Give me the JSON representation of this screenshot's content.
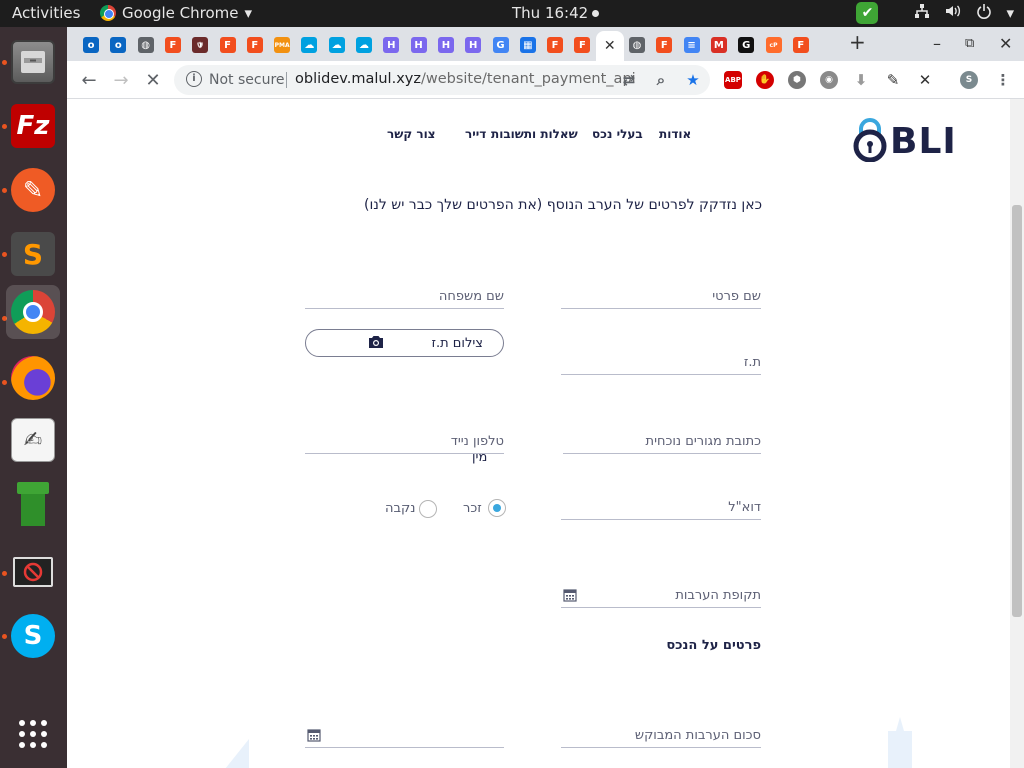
{
  "os": {
    "activities": "Activities",
    "app_name": "Google Chrome",
    "app_menu_arrow": "▾",
    "clock": "Thu 16:42",
    "tray": {
      "network_icon": "network-icon",
      "volume_icon": "volume-icon",
      "power_icon": "power-icon",
      "power_arrow": "▾"
    }
  },
  "dock": {
    "items": [
      {
        "name": "files",
        "label": "🗄",
        "color": "#6f6f6f"
      },
      {
        "name": "filezilla",
        "label": "Fz",
        "color": "#bf0000"
      },
      {
        "name": "postman",
        "label": "✎",
        "color": "#ef5b25"
      },
      {
        "name": "sublime-text",
        "label": "S",
        "color": "#4a4a4a"
      },
      {
        "name": "google-chrome",
        "label": "",
        "color": "#ffffff"
      },
      {
        "name": "firefox",
        "label": "",
        "color": "#e66000"
      },
      {
        "name": "text-editor",
        "label": "✍",
        "color": "#e8e8e8"
      },
      {
        "name": "pipe-app",
        "label": "",
        "color": "#3fa535"
      },
      {
        "name": "blocked-app",
        "label": "⃠",
        "color": "#222222"
      },
      {
        "name": "skype",
        "label": "S",
        "color": "#00aff0"
      },
      {
        "name": "show-applications",
        "label": "⋮⋮⋮",
        "color": "transparent"
      }
    ]
  },
  "browser": {
    "tabs": [
      {
        "icon": "o",
        "color": "#0a66c2"
      },
      {
        "icon": "o",
        "color": "#0a66c2"
      },
      {
        "icon": "◍",
        "color": "#5f6368"
      },
      {
        "icon": "F",
        "color": "#f24e1e"
      },
      {
        "icon": "🛡",
        "color": "#6b2a2a"
      },
      {
        "icon": "F",
        "color": "#f24e1e"
      },
      {
        "icon": "F",
        "color": "#f24e1e"
      },
      {
        "icon": "PMA",
        "color": "#f29111"
      },
      {
        "icon": "☁",
        "color": "#00a1e0"
      },
      {
        "icon": "☁",
        "color": "#00a1e0"
      },
      {
        "icon": "☁",
        "color": "#00a1e0"
      },
      {
        "icon": "H",
        "color": "#7b68ee"
      },
      {
        "icon": "H",
        "color": "#7b68ee"
      },
      {
        "icon": "H",
        "color": "#7b68ee"
      },
      {
        "icon": "H",
        "color": "#7b68ee"
      },
      {
        "icon": "G",
        "color": "#4285f4"
      },
      {
        "icon": "▦",
        "color": "#1a73e8"
      },
      {
        "icon": "F",
        "color": "#f24e1e"
      },
      {
        "icon": "F",
        "color": "#f24e1e"
      },
      {
        "icon": "✕",
        "color": "#333333",
        "active": true
      },
      {
        "icon": "◍",
        "color": "#5f6368"
      },
      {
        "icon": "F",
        "color": "#f24e1e"
      },
      {
        "icon": "≡",
        "color": "#4285f4"
      },
      {
        "icon": "M",
        "color": "#d93025"
      },
      {
        "icon": "G",
        "color": "#111111"
      },
      {
        "icon": "cP",
        "color": "#ff6c2c"
      },
      {
        "icon": "F",
        "color": "#f24e1e"
      }
    ],
    "new_tab": "+",
    "window_controls": {
      "minimize": "–",
      "restore": "⧉",
      "close": "✕"
    },
    "nav": {
      "back": "←",
      "forward": "→",
      "stop": "✕"
    },
    "omnibox": {
      "security_icon": "i",
      "security_text": "Not secure",
      "url_host": "oblidev.malul.xyz",
      "url_path": "/website/tenant_payment_api"
    },
    "extensions": [
      {
        "name": "translate-icon",
        "label": "⇄",
        "color": "#5f6368"
      },
      {
        "name": "zoom-icon",
        "label": "⌕",
        "color": "#5f6368"
      },
      {
        "name": "bookmark-star-icon",
        "label": "★",
        "color": "#1a73e8"
      },
      {
        "name": "adblock-plus-icon",
        "label": "ABP",
        "color": "#d40000"
      },
      {
        "name": "hand-stop-icon",
        "label": "✋",
        "color": "#d40000"
      },
      {
        "name": "cube-extension-icon",
        "label": "⬢",
        "color": "#777777"
      },
      {
        "name": "camera-extension-icon",
        "label": "◉",
        "color": "#8a8a8a"
      },
      {
        "name": "download-extension-icon",
        "label": "⬇",
        "color": "#9a9a9a"
      },
      {
        "name": "eyedropper-icon",
        "label": "✎",
        "color": "#333333"
      },
      {
        "name": "tools-extension-icon",
        "label": "✕",
        "color": "#333333"
      },
      {
        "name": "profile-avatar",
        "label": "S",
        "color": "#7b8a8f"
      },
      {
        "name": "more-menu-icon",
        "label": "⋮",
        "color": "#5f6368"
      }
    ]
  },
  "site": {
    "logo_text": "BLI",
    "nav": {
      "about": "אודות",
      "owners": "בעלי נכס",
      "faq": "שאלות ותשובות",
      "tenant": "דייר",
      "contact": "צור קשר"
    },
    "form": {
      "intro": "כאן נזדקק לפרטים של הערב הנוסף (את הפרטים שלך כבר יש לנו)",
      "first_name_placeholder": "שם פרטי",
      "last_name_placeholder": "שם משפחה",
      "id_placeholder": "ת.ז",
      "id_photo_label": "צילום ת.ז",
      "address_placeholder": "כתובת מגורים נוכחית",
      "phone_placeholder": "טלפון נייד",
      "email_placeholder": "דוא\"ל",
      "gender_label": "מין",
      "gender_options": [
        "זכר",
        "נקבה"
      ],
      "gender_selected": "זכר",
      "guarantee_period_placeholder": "תקופת הערבות",
      "property_section_title": "פרטים על הנכס",
      "requested_amount_placeholder": "סכום הערבות המבוקש"
    },
    "colors": {
      "brand": "#1e2347",
      "accent": "#3aa7de"
    }
  }
}
